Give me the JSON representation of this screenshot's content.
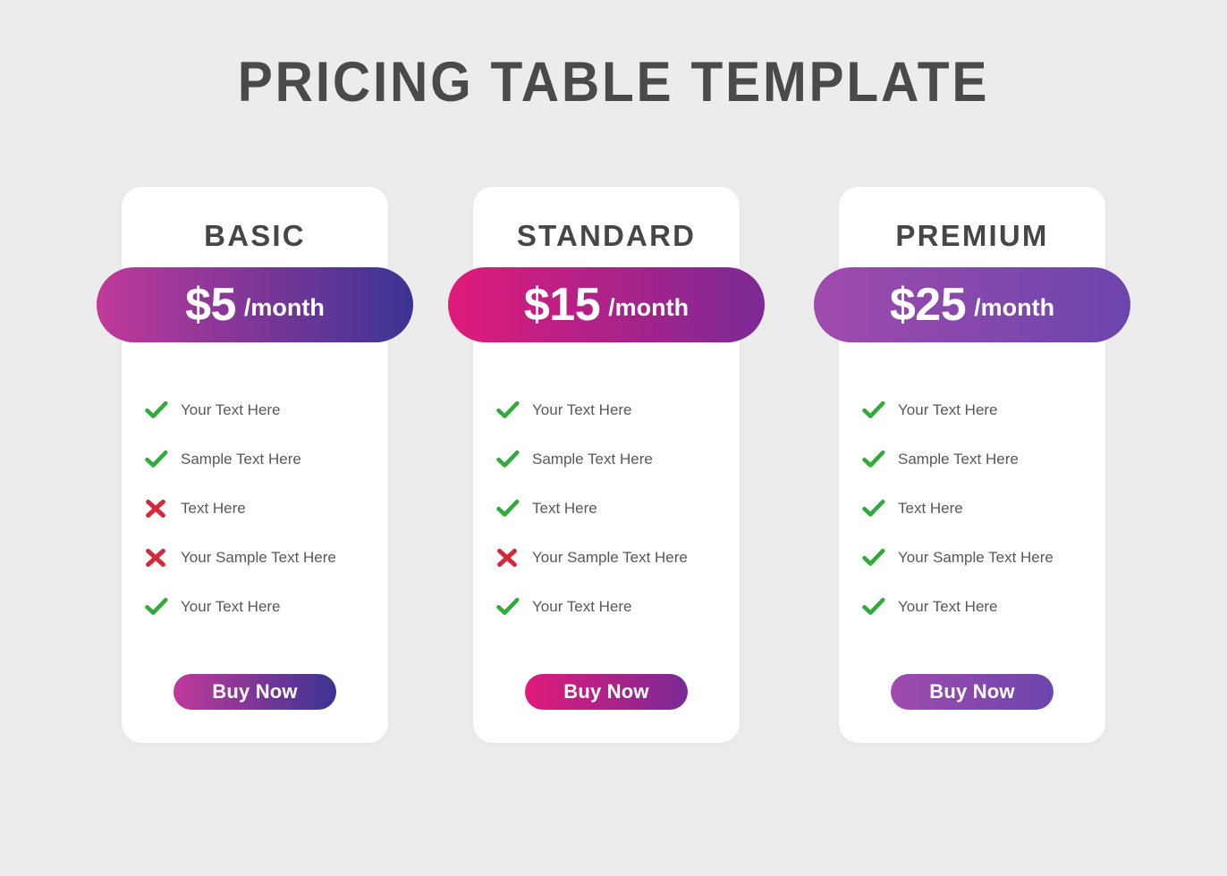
{
  "page": {
    "title": "PRICING TABLE TEMPLATE",
    "background_color": "#ececec",
    "title_color": "#4a4a4a"
  },
  "icons": {
    "check": "check-icon",
    "cross": "cross-icon",
    "check_color": "#32ab3c",
    "cross_color": "#d62839"
  },
  "plans": [
    {
      "name": "BASIC",
      "price": "$5",
      "period": "/month",
      "gradient_from": "#c0399a",
      "gradient_to": "#3b3494",
      "button_label": "Buy Now",
      "features": [
        {
          "label": "Your Text Here",
          "included": true
        },
        {
          "label": "Sample Text Here",
          "included": true
        },
        {
          "label": "Text Here",
          "included": false
        },
        {
          "label": "Your Sample Text Here",
          "included": false
        },
        {
          "label": "Your Text Here",
          "included": true
        }
      ]
    },
    {
      "name": "STANDARD",
      "price": "$15",
      "period": "/month",
      "gradient_from": "#e01a7a",
      "gradient_to": "#7b2a96",
      "button_label": "Buy Now",
      "features": [
        {
          "label": "Your Text Here",
          "included": true
        },
        {
          "label": "Sample Text Here",
          "included": true
        },
        {
          "label": "Text Here",
          "included": true
        },
        {
          "label": "Your Sample Text Here",
          "included": false
        },
        {
          "label": "Your Text Here",
          "included": true
        }
      ]
    },
    {
      "name": "PREMIUM",
      "price": "$25",
      "period": "/month",
      "gradient_from": "#a04aad",
      "gradient_to": "#6b46ad",
      "button_label": "Buy Now",
      "features": [
        {
          "label": "Your Text Here",
          "included": true
        },
        {
          "label": "Sample Text Here",
          "included": true
        },
        {
          "label": "Text Here",
          "included": true
        },
        {
          "label": "Your Sample Text Here",
          "included": true
        },
        {
          "label": "Your Text Here",
          "included": true
        }
      ]
    }
  ]
}
